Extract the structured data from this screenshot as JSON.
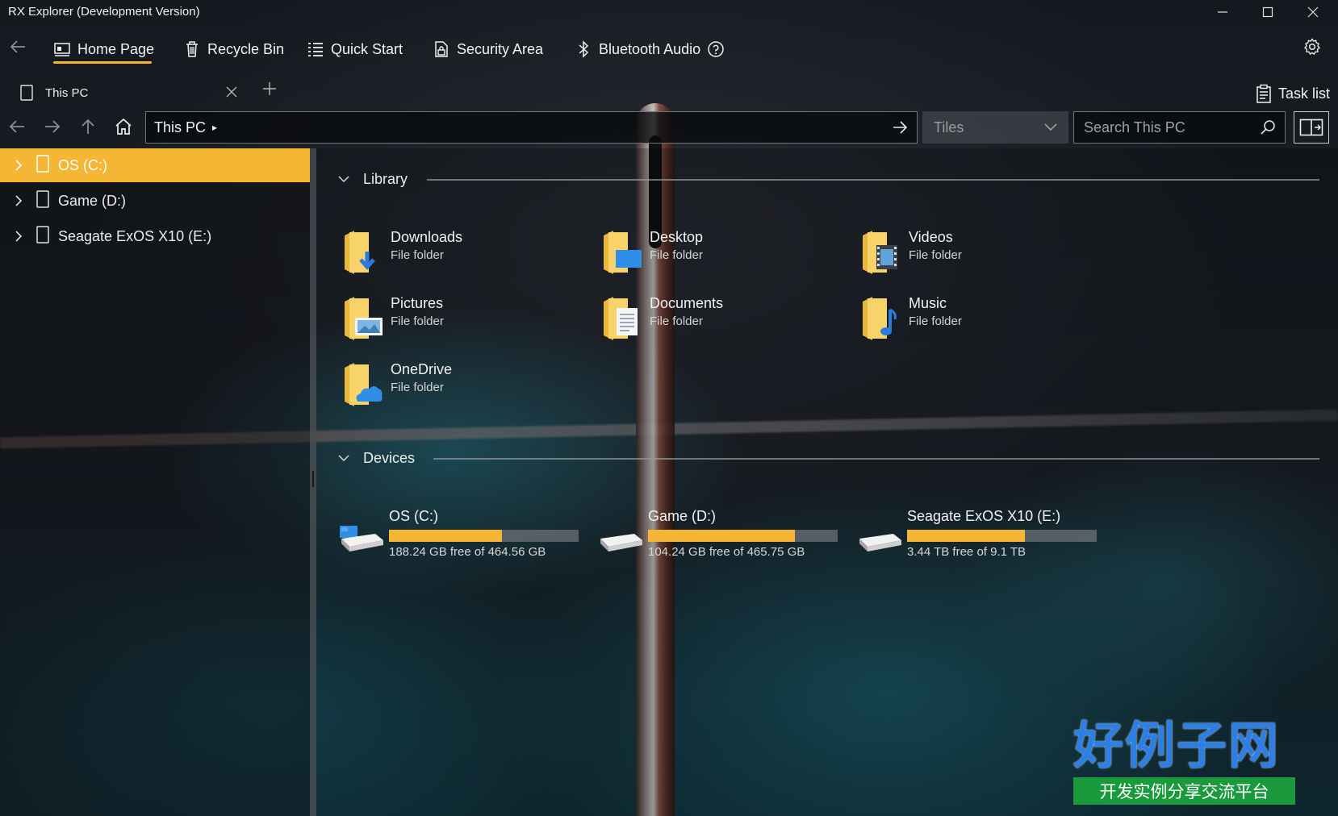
{
  "window": {
    "title": "RX Explorer (Development Version)",
    "controls": {
      "minimize": "—",
      "maximize": "☐",
      "close": "✕"
    }
  },
  "nav": {
    "items": [
      {
        "label": "Home Page",
        "icon": "home-page-icon",
        "active": true
      },
      {
        "label": "Recycle Bin",
        "icon": "trash-icon"
      },
      {
        "label": "Quick Start",
        "icon": "list-icon"
      },
      {
        "label": "Security Area",
        "icon": "lock-icon"
      },
      {
        "label": "Bluetooth Audio",
        "icon": "bluetooth-icon"
      }
    ],
    "accent_color": "#f5b535"
  },
  "tabs": [
    {
      "label": "This PC"
    }
  ],
  "task_list_label": "Task list",
  "address": {
    "path": "This PC",
    "separator": "▸",
    "view_mode": "Tiles",
    "search_placeholder": "Search This PC"
  },
  "tree": {
    "items": [
      {
        "label": "OS (C:)",
        "selected": true
      },
      {
        "label": "Game (D:)"
      },
      {
        "label": "Seagate ExOS X10 (E:)"
      }
    ]
  },
  "library": {
    "title": "Library",
    "folders": [
      {
        "name": "Downloads",
        "type": "File folder",
        "icon": "downloads-folder-icon"
      },
      {
        "name": "Desktop",
        "type": "File folder",
        "icon": "desktop-folder-icon"
      },
      {
        "name": "Videos",
        "type": "File folder",
        "icon": "videos-folder-icon"
      },
      {
        "name": "Pictures",
        "type": "File folder",
        "icon": "pictures-folder-icon"
      },
      {
        "name": "Documents",
        "type": "File folder",
        "icon": "documents-folder-icon"
      },
      {
        "name": "Music",
        "type": "File folder",
        "icon": "music-folder-icon"
      },
      {
        "name": "OneDrive",
        "type": "File folder",
        "icon": "onedrive-folder-icon"
      }
    ]
  },
  "devices": {
    "title": "Devices",
    "drives": [
      {
        "name": "OS (C:)",
        "free_text": "188.24 GB free of 464.56 GB",
        "used_fraction": 0.595
      },
      {
        "name": "Game (D:)",
        "free_text": "104.24 GB free of 465.75 GB",
        "used_fraction": 0.776
      },
      {
        "name": "Seagate ExOS X10 (E:)",
        "free_text": "3.44 TB free of 9.1 TB",
        "used_fraction": 0.622
      }
    ]
  },
  "watermark": {
    "big": "好例子网",
    "small": "开发实例分享交流平台"
  }
}
